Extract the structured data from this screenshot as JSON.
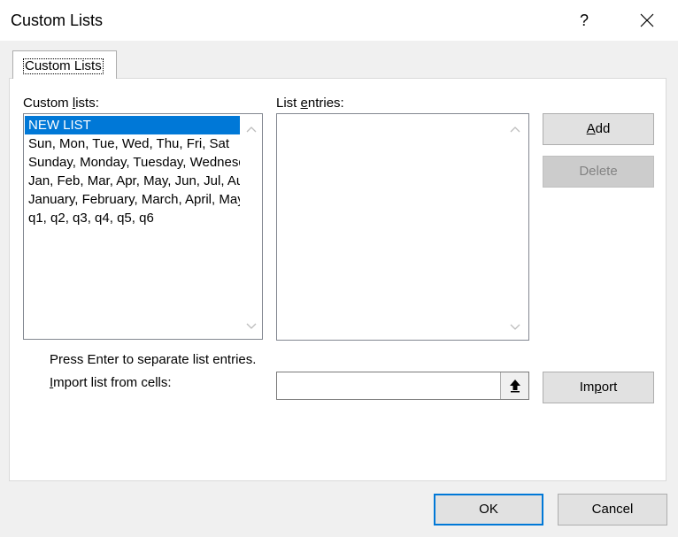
{
  "window": {
    "title": "Custom Lists",
    "help_label": "?",
    "close_icon": "close-icon"
  },
  "tab": {
    "label": "Custom Lists"
  },
  "custom_lists": {
    "label_pre": "Custom ",
    "label_accel": "l",
    "label_post": "ists:",
    "items": [
      "NEW LIST",
      "Sun, Mon, Tue, Wed, Thu, Fri, Sat",
      "Sunday, Monday, Tuesday, Wednesday, Thursday, Friday, Saturday",
      "Jan, Feb, Mar, Apr, May, Jun, Jul, Aug, Sep, Oct, Nov, Dec",
      "January, February, March, April, May, June, July, August, September, October, November, December",
      "q1, q2, q3, q4, q5, q6"
    ],
    "selected_index": 0
  },
  "list_entries": {
    "label_pre": "List ",
    "label_accel": "e",
    "label_post": "ntries:",
    "value": ""
  },
  "buttons": {
    "add_accel": "A",
    "add_rest": "dd",
    "delete": "Delete",
    "import_pre": "Im",
    "import_accel": "p",
    "import_post": "ort",
    "ok": "OK",
    "cancel": "Cancel"
  },
  "hint": "Press Enter to separate list entries.",
  "import_field": {
    "label_accel": "I",
    "label_rest": "mport list from cells:",
    "value": "",
    "ref_icon": "collapse-dialog-icon"
  },
  "colors": {
    "selection": "#0078d7",
    "default_button_border": "#0078d7"
  }
}
